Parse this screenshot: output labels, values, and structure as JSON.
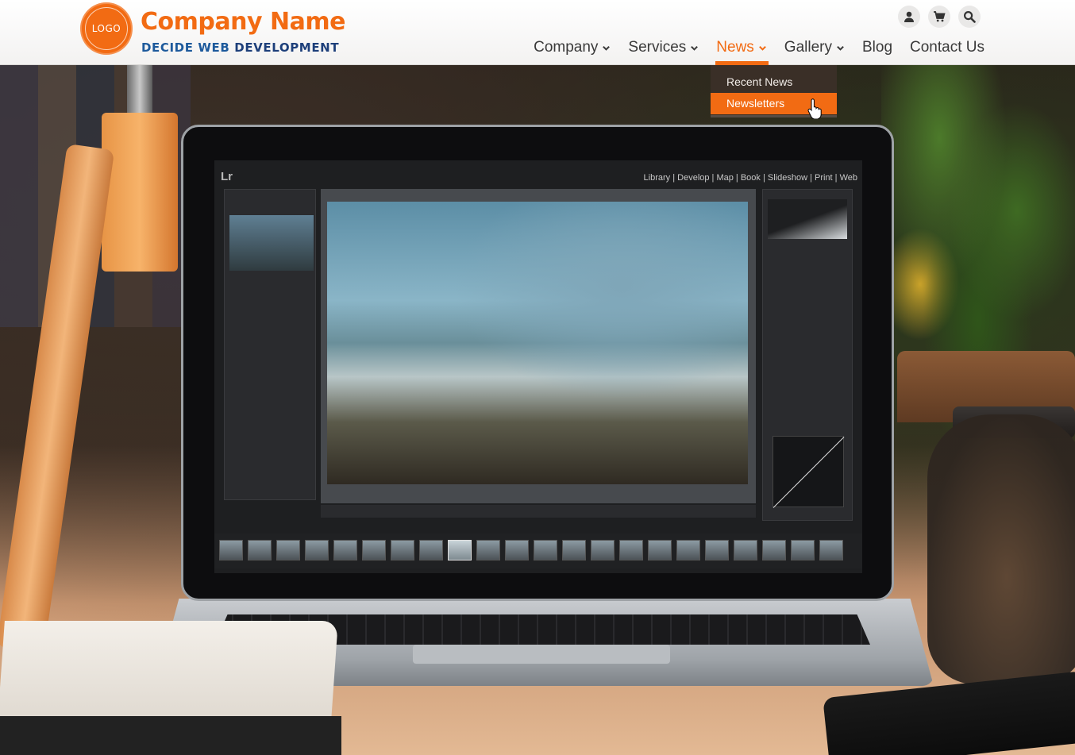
{
  "header": {
    "logo_text": "LOGO",
    "company_name": "Company Name",
    "tagline_part1": "DECIDE WEB ",
    "tagline_part2": "DEVELOPMENT"
  },
  "utility_icons": [
    "user-icon",
    "cart-icon",
    "search-icon"
  ],
  "nav": {
    "items": [
      {
        "label": "Company",
        "has_dropdown": true
      },
      {
        "label": "Services",
        "has_dropdown": true
      },
      {
        "label": "News",
        "has_dropdown": true,
        "active": true
      },
      {
        "label": "Gallery",
        "has_dropdown": true
      },
      {
        "label": "Blog",
        "has_dropdown": false
      },
      {
        "label": "Contact Us",
        "has_dropdown": false
      }
    ]
  },
  "dropdown": {
    "items": [
      {
        "label": "Recent News"
      },
      {
        "label": "Newsletters",
        "hover": true
      }
    ]
  },
  "hero": {
    "lr_brand": "Lr",
    "lr_modules": "Library | Develop | Map | Book | Slideshow | Print | Web"
  },
  "colors": {
    "accent": "#f26b13",
    "tagline_blue": "#1d5a9c",
    "nav_text": "#3a3a3a",
    "dropdown_bg": "#3c3028"
  }
}
